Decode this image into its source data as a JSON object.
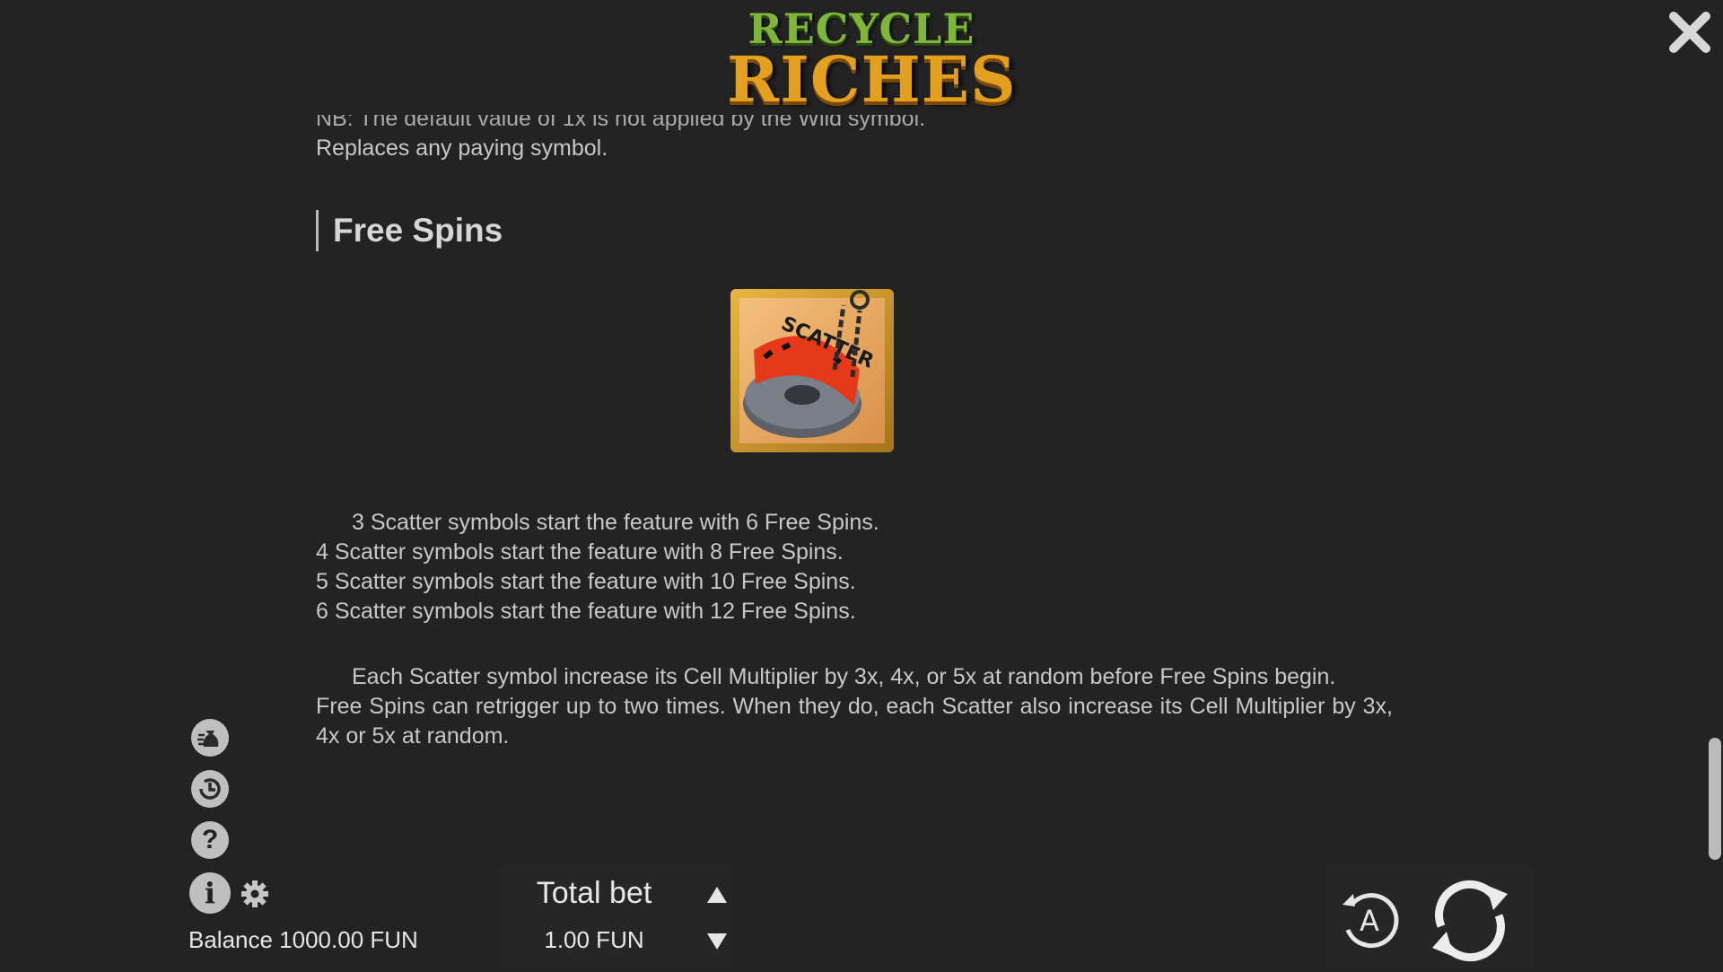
{
  "logo": {
    "line1": "RECYCLE",
    "line2": "RICHES"
  },
  "content": {
    "cut_line": "NB: The default value of 1x is not applied by the Wild symbol.",
    "replaces": "Replaces any paying symbol.",
    "section_title": "Free Spins",
    "scatter_label": "SCATTER",
    "scatter_lines": [
      "3 Scatter symbols start the feature with 6 Free Spins.",
      "4 Scatter symbols start the feature with 8 Free Spins.",
      "5 Scatter symbols start the feature with 10 Free Spins.",
      "6 Scatter symbols start the feature with 12 Free Spins."
    ],
    "multiplier_text": "Each Scatter symbol increase its Cell Multiplier by 3x, 4x, or 5x at random before Free Spins begin.",
    "retrigger_text": "Free Spins can retrigger up to two times. When they do, each Scatter also increase its Cell Multiplier by 3x, 4x or 5x at random."
  },
  "sidebar": {
    "icons": [
      "money-bag-icon",
      "history-icon",
      "help-icon",
      "info-icon",
      "gear-icon"
    ],
    "help_glyph": "?",
    "info_glyph": "i"
  },
  "footer": {
    "balance": "Balance 1000.00 FUN",
    "total_bet_label": "Total bet",
    "total_bet_value": "1.00 FUN",
    "autoplay_glyph": "A"
  }
}
